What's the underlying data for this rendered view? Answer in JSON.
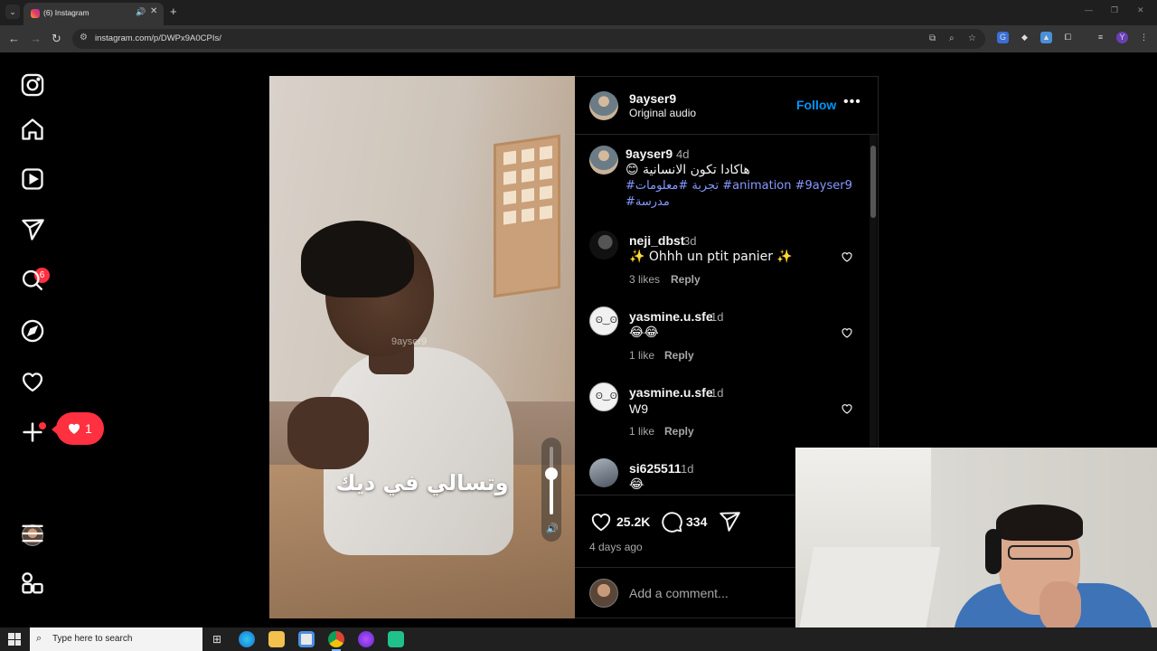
{
  "browser": {
    "tab_title": "(6) Instagram",
    "url": "instagram.com/p/DWPx9A0CPIs/"
  },
  "sidebar": {
    "messages_badge": "6",
    "notifications_count": "1",
    "items": [
      {
        "name": "instagram"
      },
      {
        "name": "home"
      },
      {
        "name": "reels"
      },
      {
        "name": "messages"
      },
      {
        "name": "search"
      },
      {
        "name": "explore"
      },
      {
        "name": "notifications"
      },
      {
        "name": "create"
      },
      {
        "name": "profile"
      },
      {
        "name": "more"
      },
      {
        "name": "also-from-meta"
      }
    ]
  },
  "video": {
    "watermark": "9ayser9",
    "caption": "وتسالي في ديك",
    "volume_level": 0.6
  },
  "post": {
    "author": "9ayser9",
    "audio": "Original audio",
    "follow_label": "Follow",
    "caption": {
      "user": "9ayser9",
      "time": "4d",
      "text": "هاكادا تكون الانسانية 😊",
      "tags_line1": "#تجربة #معلومات #animation #9ayser9",
      "tags_line2": "#مدرسة"
    },
    "comments": [
      {
        "user": "neji_dbst",
        "time": "3d",
        "text": "✨ Ohhh un ptit panier ✨",
        "likes": "3 likes",
        "reply": "Reply"
      },
      {
        "user": "yasmine.u.sfe",
        "time": "1d",
        "text": "😂😂",
        "likes": "1 like",
        "reply": "Reply"
      },
      {
        "user": "yasmine.u.sfe",
        "time": "1d",
        "text": "W9",
        "likes": "1 like",
        "reply": "Reply"
      },
      {
        "user": "si625511",
        "time": "1d",
        "text": "😂",
        "likes": "",
        "reply": ""
      }
    ],
    "like_count": "25.2K",
    "comment_count": "334",
    "posted_ago": "4 days ago",
    "add_comment_placeholder": "Add a comment..."
  },
  "taskbar": {
    "search_placeholder": "Type here to search"
  },
  "colors": {
    "accent_blue": "#0095f6",
    "hashtag": "#8599ff",
    "badge_red": "#ff3040"
  }
}
